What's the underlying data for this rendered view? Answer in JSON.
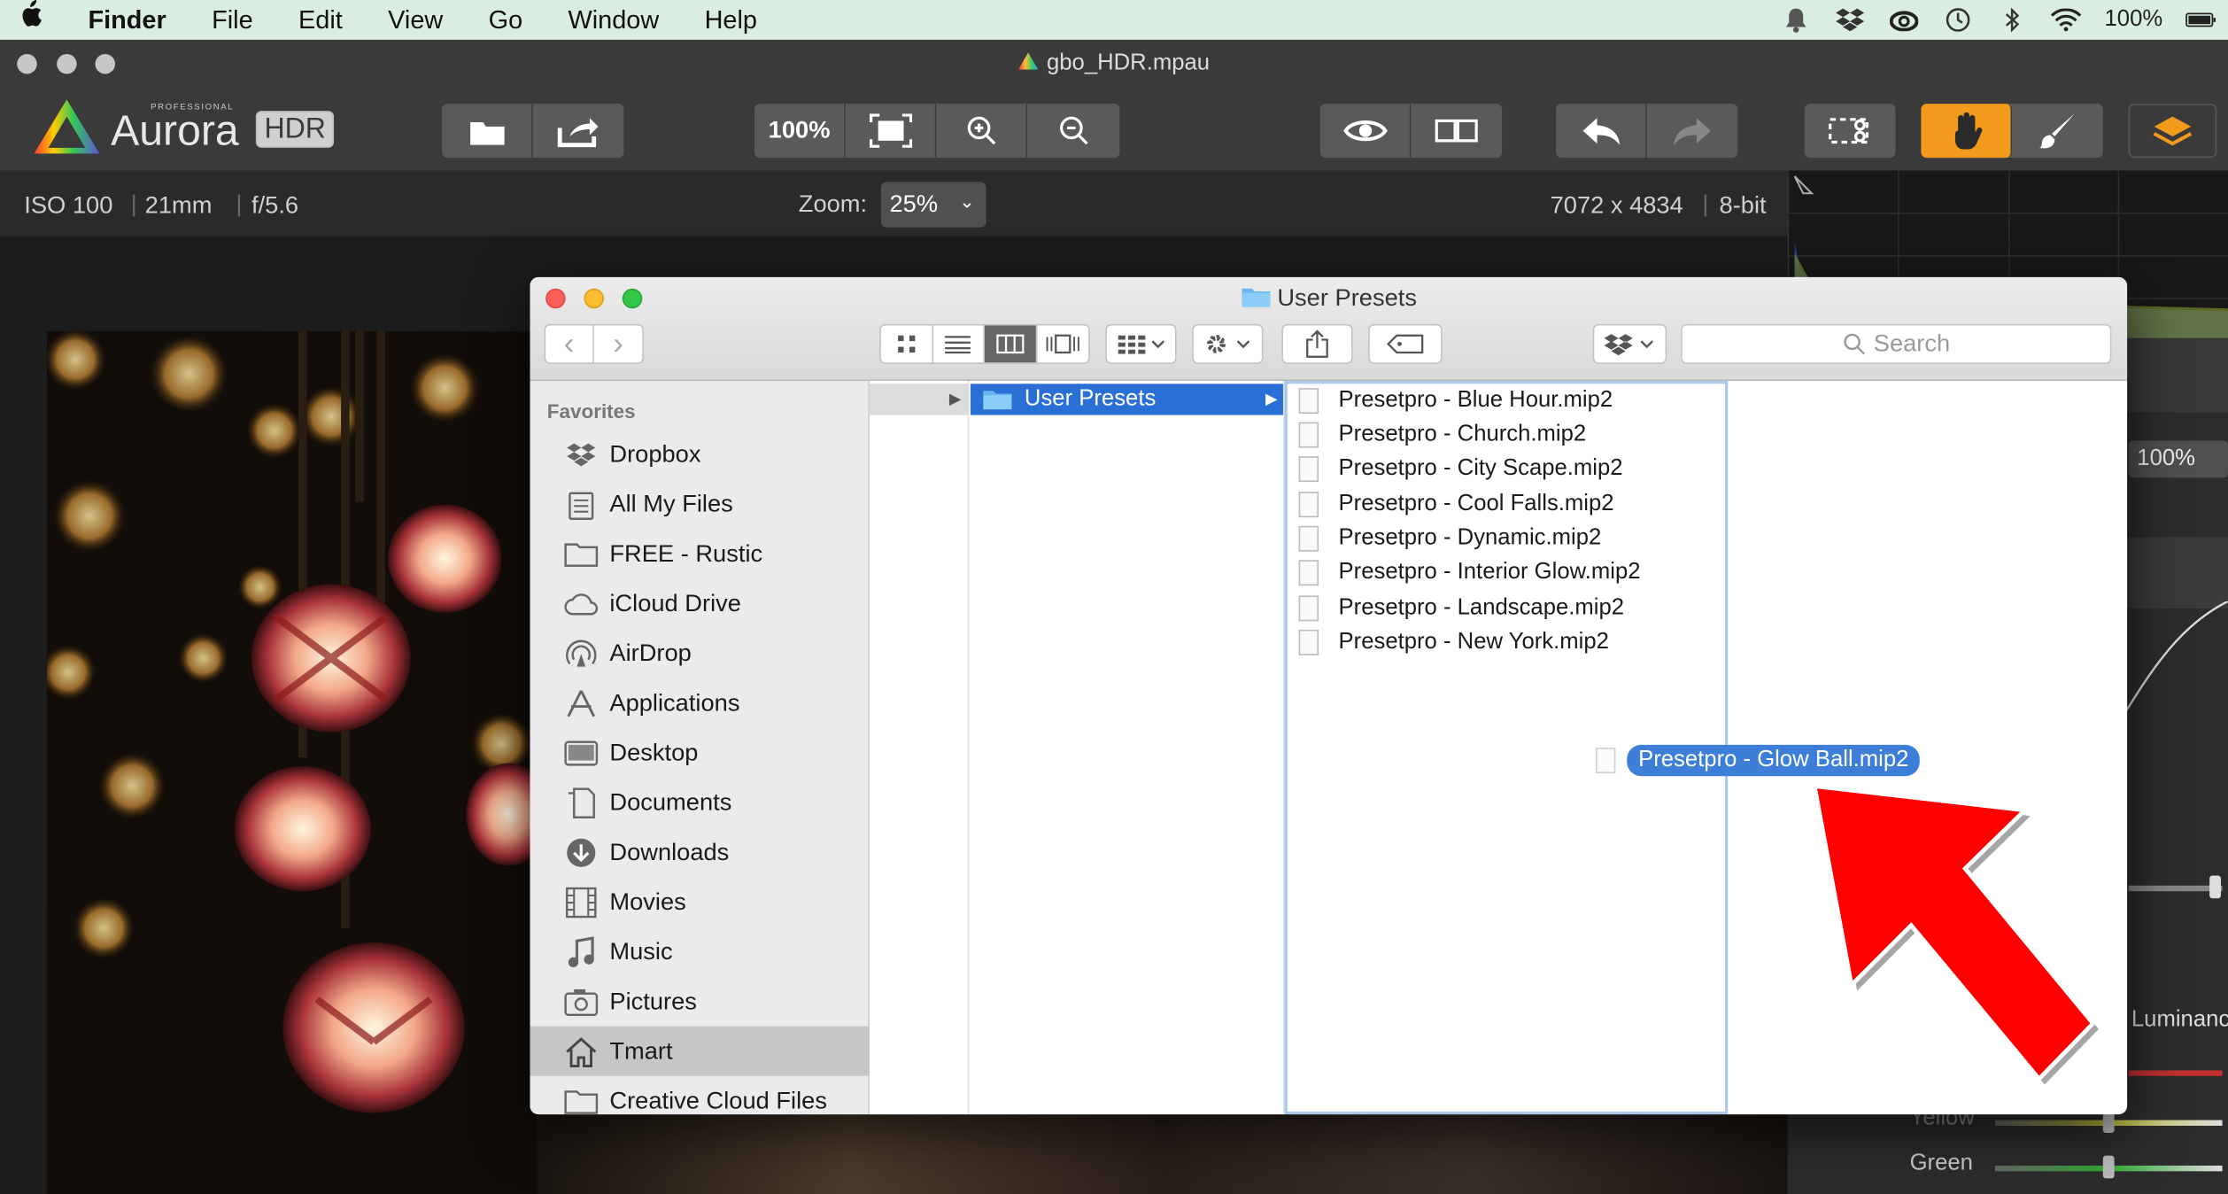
{
  "menubar": {
    "app": "Finder",
    "items": [
      "File",
      "Edit",
      "View",
      "Go",
      "Window",
      "Help"
    ],
    "battery": "100%"
  },
  "app_window": {
    "title": "gbo_HDR.mpau",
    "logo_small": "PROFESSIONAL",
    "logo_text": "Aurora",
    "logo_badge": "HDR",
    "zoom_button": "100%"
  },
  "infobar": {
    "iso": "ISO 100",
    "focal": "21mm",
    "aperture": "f/5.6",
    "zoom_label": "Zoom:",
    "zoom_value": "25%",
    "dimensions": "7072 x 4834",
    "bit_depth": "8-bit"
  },
  "right_panel": {
    "zoom_value": "100%",
    "luminance_label": "Luminanc",
    "yellow_label": "Yellow",
    "green_label": "Green"
  },
  "finder": {
    "title": "User Presets",
    "search_placeholder": "Search",
    "sidebar": {
      "heading": "Favorites",
      "items": [
        {
          "label": "Dropbox",
          "icon": "dropbox-icon"
        },
        {
          "label": "All My Files",
          "icon": "all-files-icon"
        },
        {
          "label": "FREE - Rustic",
          "icon": "folder-icon"
        },
        {
          "label": "iCloud Drive",
          "icon": "cloud-icon"
        },
        {
          "label": "AirDrop",
          "icon": "airdrop-icon"
        },
        {
          "label": "Applications",
          "icon": "applications-icon"
        },
        {
          "label": "Desktop",
          "icon": "desktop-icon"
        },
        {
          "label": "Documents",
          "icon": "documents-icon"
        },
        {
          "label": "Downloads",
          "icon": "downloads-icon"
        },
        {
          "label": "Movies",
          "icon": "movies-icon"
        },
        {
          "label": "Music",
          "icon": "music-icon"
        },
        {
          "label": "Pictures",
          "icon": "pictures-icon"
        },
        {
          "label": "Tmart",
          "icon": "home-icon"
        },
        {
          "label": "Creative Cloud Files",
          "icon": "folder-icon"
        }
      ]
    },
    "column2_selected": "User Presets",
    "files": [
      "Presetpro - Blue Hour.mip2",
      "Presetpro - Church.mip2",
      "Presetpro - City Scape.mip2",
      "Presetpro - Cool Falls.mip2",
      "Presetpro - Dynamic.mip2",
      "Presetpro - Interior Glow.mip2",
      "Presetpro - Landscape.mip2",
      "Presetpro - New York.mip2"
    ],
    "dragged_file": "Presetpro - Glow Ball.mip2"
  },
  "colors": {
    "menubar_bg": "#d9eee0",
    "accent_orange": "#f29a1b",
    "selection_blue": "#2a6fd6",
    "arrow_red": "#ff0000"
  }
}
